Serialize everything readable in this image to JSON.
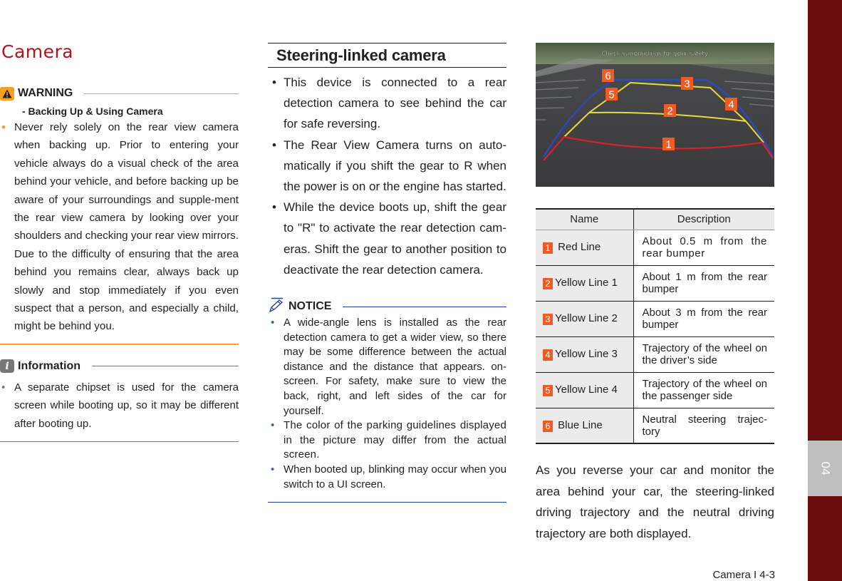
{
  "page": {
    "title": "Camera",
    "footer": "Camera I 4-3",
    "chapter_tab": "04"
  },
  "colors": {
    "title": "#b5121b",
    "warning_accent": "#f5a11f",
    "info_accent": "#767779",
    "notice_accent": "#1d3f8f",
    "badge": "#ef5b24",
    "side_tab": "#6b0c0d",
    "chapter_tab_bg": "#bfbfbf",
    "guide_red": "#e3202a",
    "guide_yellow": "#e5dc3a",
    "guide_blue": "#2f49b8"
  },
  "warning": {
    "label": "WARNING",
    "icon": "warning-triangle-icon",
    "subtitle": "- Backing Up & Using Camera",
    "items": [
      "Never rely solely on the rear view camera when backing up. Prior to entering your vehicle always do a visual check of the area behind your vehicle, and before backing up be aware of your surroundings and supple-ment the rear view camera by looking over your shoulders and checking your rear view mirrors. Due to the difficulty of ensuring that the area behind you remains clear, always back up slowly and stop immediately if you even suspect that a person, and especially a child, might be behind you."
    ]
  },
  "information": {
    "label": "Information",
    "icon": "info-icon",
    "icon_glyph": "i",
    "items": [
      "A separate chipset is used for the camera screen while booting up, so it may be different after booting up."
    ]
  },
  "steering_section": {
    "title": "Steering-linked camera",
    "items": [
      "This device is connected to a rear detection camera to see behind the car for safe reversing.",
      "The Rear View Camera turns on auto-matically if you shift the gear to R when the power is on or the engine has started.",
      "While the device boots up, shift the gear to \"R\" to activate the rear detection cam-eras. Shift the gear to another position to deactivate the rear detection camera."
    ]
  },
  "notice": {
    "label": "NOTICE",
    "icon": "pencil-icon",
    "items": [
      "A wide-angle lens is installed as the rear detection camera to get a wider view, so there may be some difference between the actual distance and the distance that appears. on-screen. For safety, make sure to view the back, right, and left sides of the car for yourself.",
      "The color of the parking guidelines displayed in the picture may differ from the actual screen.",
      "When booted up, blinking may occur when you switch to a UI screen."
    ]
  },
  "camera_view": {
    "overlay_text": "Check surroundings for your safety.",
    "markers": [
      "1",
      "2",
      "3",
      "4",
      "5",
      "6"
    ]
  },
  "guide_table": {
    "headers": [
      "Name",
      "Description"
    ],
    "rows": [
      {
        "num": "1",
        "name": "Red Line",
        "desc": "About 0.5 m from the rear bumper"
      },
      {
        "num": "2",
        "name": "Yellow Line 1",
        "desc": "About 1 m from the rear bumper"
      },
      {
        "num": "3",
        "name": "Yellow Line 2",
        "desc": "About 3 m from the rear bumper"
      },
      {
        "num": "4",
        "name": "Yellow Line 3",
        "desc": "Trajectory of the wheel on the driver’s side"
      },
      {
        "num": "5",
        "name": "Yellow Line 4",
        "desc": "Trajectory of the wheel on the passenger side"
      },
      {
        "num": "6",
        "name": "Blue Line",
        "desc": "Neutral steering trajec-tory"
      }
    ]
  },
  "closing_text": "As you reverse your car and monitor the area behind your car, the steering-linked driving trajectory and the neutral driving trajectory are both displayed."
}
